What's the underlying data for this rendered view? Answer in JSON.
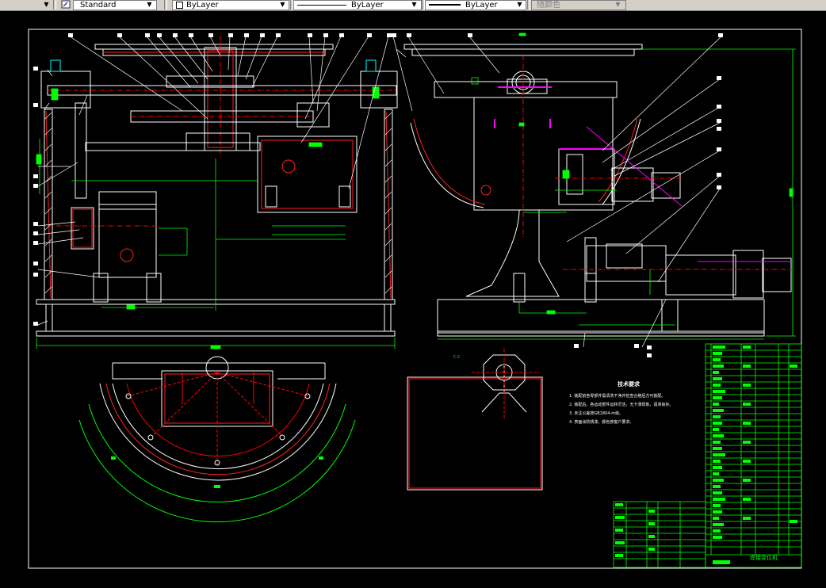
{
  "toolbar": {
    "text_style": "Standard",
    "layer": "ByLayer",
    "linetype": "ByLayer",
    "lineweight": "ByLayer",
    "plot_style": "随颜色"
  },
  "drawing": {
    "section_label": "C-C",
    "title_block_name": "焊接变位机",
    "tech_notes_title": "技术要求",
    "tech_notes": [
      "1. 装配前各零部件需清洗干净并检查合格后方可装配。",
      "2. 装配后，各运动部件运转灵活，无卡滞现象，润滑良好。",
      "3. 未注公差按GB1804-m级。",
      "4. 表面涂防锈漆，颜色按客户要求。"
    ],
    "colors": {
      "outline": "#ffffff",
      "hatch": "#ff2020",
      "dim": "#00ff00",
      "center": "#ff0000",
      "aux": "#ff00ff",
      "accent": "#00ffff"
    }
  }
}
